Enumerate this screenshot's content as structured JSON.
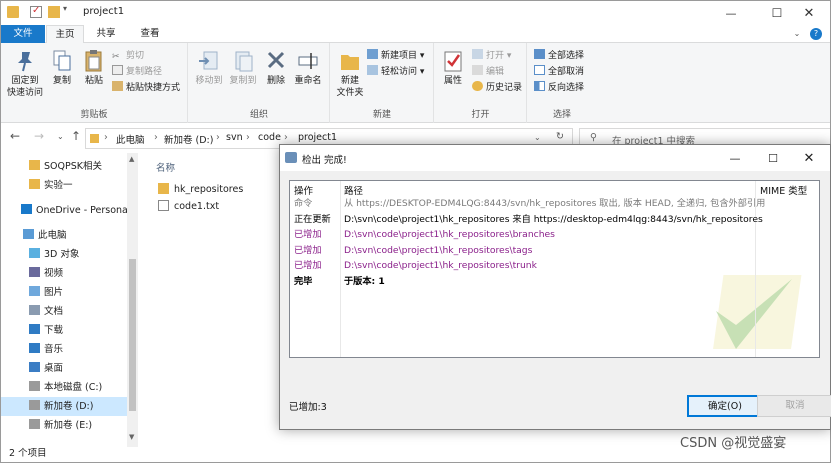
{
  "window": {
    "title": "project1"
  },
  "tabs": [
    "文件",
    "主页",
    "共享",
    "查看"
  ],
  "ribbon": {
    "clipboard": {
      "label": "剪贴板",
      "pin": "固定到\n快速访问",
      "copy": "复制",
      "paste": "粘贴",
      "cut": "剪切",
      "copy_path": "复制路径",
      "paste_shortcut": "粘贴快捷方式"
    },
    "organize": {
      "label": "组织",
      "move_to": "移动到",
      "copy_to": "复制到",
      "delete": "删除",
      "rename": "重命名"
    },
    "new": {
      "label": "新建",
      "new_folder": "新建\n文件夹",
      "new_item": "新建项目",
      "easy_access": "轻松访问"
    },
    "open": {
      "label": "打开",
      "properties": "属性",
      "open": "打开",
      "edit": "编辑",
      "history": "历史记录"
    },
    "select": {
      "label": "选择",
      "select_all": "全部选择",
      "select_none": "全部取消",
      "invert": "反向选择"
    }
  },
  "address": {
    "crumbs": [
      "此电脑",
      "新加卷 (D:)",
      "svn",
      "code",
      "project1"
    ],
    "search_placeholder": "在 project1 中搜索"
  },
  "nav": [
    {
      "label": "SOQPSK相关",
      "icon": "folder-icon"
    },
    {
      "label": "实验一",
      "icon": "folder-icon"
    },
    {
      "label": "OneDrive - Personal",
      "icon": "cloud-icon"
    },
    {
      "label": "此电脑",
      "icon": "computer-icon"
    },
    {
      "label": "3D 对象",
      "icon": "cube-icon"
    },
    {
      "label": "视频",
      "icon": "video-icon"
    },
    {
      "label": "图片",
      "icon": "picture-icon"
    },
    {
      "label": "文档",
      "icon": "document-icon"
    },
    {
      "label": "下载",
      "icon": "download-icon"
    },
    {
      "label": "音乐",
      "icon": "music-icon"
    },
    {
      "label": "桌面",
      "icon": "desktop-icon"
    },
    {
      "label": "本地磁盘 (C:)",
      "icon": "drive-icon"
    },
    {
      "label": "新加卷 (D:)",
      "icon": "drive-icon"
    },
    {
      "label": "新加卷 (E:)",
      "icon": "drive-icon"
    }
  ],
  "content": {
    "column_name": "名称",
    "files": [
      {
        "name": "hk_repositores",
        "icon": "folder-icon"
      },
      {
        "name": "code1.txt",
        "icon": "text-file-icon"
      }
    ]
  },
  "status": {
    "count": "2 个项目"
  },
  "dialog": {
    "title": "检出 完成!",
    "headers": {
      "action": "操作",
      "path": "路径",
      "mime": "MIME 类型"
    },
    "rows": [
      {
        "action": "命令",
        "path": "从 https://DESKTOP-EDM4LQG:8443/svn/hk_repositores 取出, 版本 HEAD, 全递归, 包含外部引用",
        "color": "gray"
      },
      {
        "action": "正在更新",
        "path": "D:\\svn\\code\\project1\\hk_repositores 来自 https://desktop-edm4lqg:8443/svn/hk_repositores",
        "color": "black"
      },
      {
        "action": "已增加",
        "path": "D:\\svn\\code\\project1\\hk_repositores\\branches",
        "color": "purple"
      },
      {
        "action": "已增加",
        "path": "D:\\svn\\code\\project1\\hk_repositores\\tags",
        "color": "purple"
      },
      {
        "action": "已增加",
        "path": "D:\\svn\\code\\project1\\hk_repositores\\trunk",
        "color": "purple"
      },
      {
        "action": "完毕",
        "path": "于版本: 1",
        "color": "bold"
      }
    ],
    "status": "已增加:3",
    "ok": "确定(O)",
    "cancel": "取消"
  },
  "watermark": "CSDN @视觉盛宴"
}
